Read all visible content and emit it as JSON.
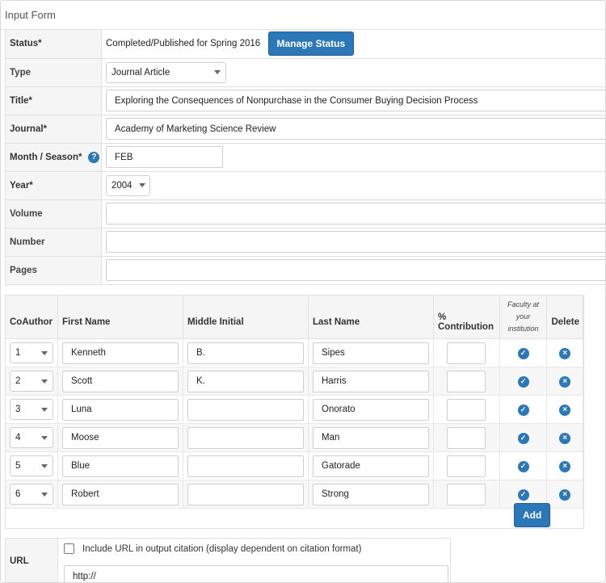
{
  "panel": {
    "title": "Input Form"
  },
  "form": {
    "status": {
      "label": "Status*",
      "value": "Completed/Published for Spring 2016",
      "button": "Manage Status"
    },
    "type": {
      "label": "Type",
      "value": "Journal Article"
    },
    "title": {
      "label": "Title*",
      "value": "Exploring the Consequences of Nonpurchase in the Consumer Buying Decision Process"
    },
    "journal": {
      "label": "Journal*",
      "value": "Academy of Marketing Science Review"
    },
    "month": {
      "label": "Month / Season*",
      "value": "FEB",
      "help": "?"
    },
    "year": {
      "label": "Year*",
      "value": "2004"
    },
    "volume": {
      "label": "Volume",
      "value": ""
    },
    "number": {
      "label": "Number",
      "value": ""
    },
    "pages": {
      "label": "Pages",
      "value": ""
    }
  },
  "coauthors": {
    "headers": {
      "coauthor": "CoAuthor",
      "first": "First Name",
      "middle": "Middle Initial",
      "last": "Last Name",
      "contribution": "% Contribution",
      "faculty": "Faculty at your institution",
      "delete": "Delete"
    },
    "rows": [
      {
        "order": "1",
        "first": "Kenneth",
        "middle": "B.",
        "last": "Sipes",
        "contribution": ""
      },
      {
        "order": "2",
        "first": "Scott",
        "middle": "K.",
        "last": "Harris",
        "contribution": ""
      },
      {
        "order": "3",
        "first": "Luna",
        "middle": "",
        "last": "Onorato",
        "contribution": ""
      },
      {
        "order": "4",
        "first": "Moose",
        "middle": "",
        "last": "Man",
        "contribution": ""
      },
      {
        "order": "5",
        "first": "Blue",
        "middle": "",
        "last": "Gatorade",
        "contribution": ""
      },
      {
        "order": "6",
        "first": "Robert",
        "middle": "",
        "last": "Strong",
        "contribution": ""
      }
    ],
    "add_label": "Add"
  },
  "url": {
    "label": "URL",
    "checkbox_label": "Include URL in output citation (display dependent on citation format)",
    "value": "http://"
  },
  "colors": {
    "accent": "#2b78b8"
  },
  "icons": {
    "check": "check-circle-icon",
    "delete": "x-circle-icon",
    "help": "question-circle-icon",
    "caret": "chevron-down-icon"
  }
}
